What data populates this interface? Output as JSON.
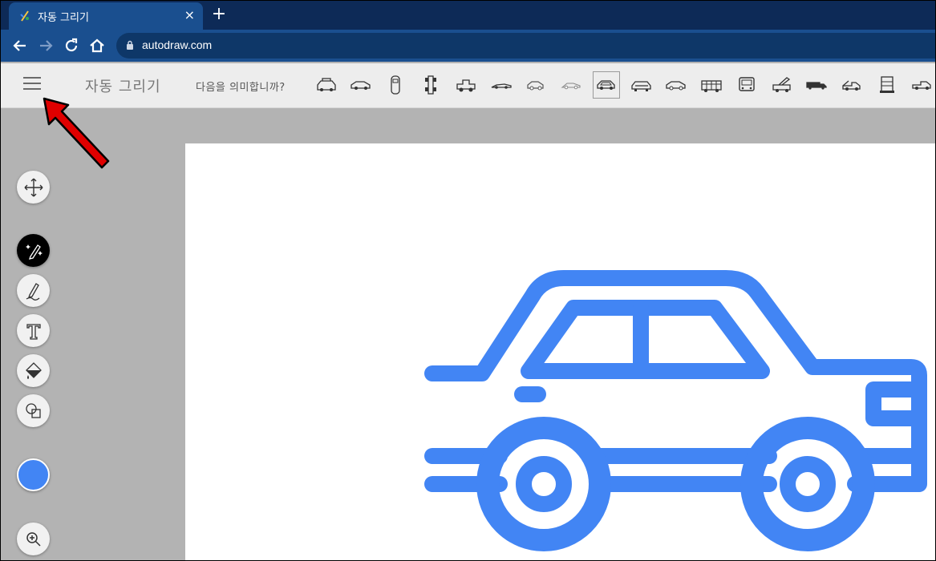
{
  "browser": {
    "tab_title": "자동 그리기",
    "tab_close": "×",
    "new_tab": "+",
    "url": "autodraw.com"
  },
  "app": {
    "title": "자동  그리기",
    "prompt": "다음을 의미합니까?",
    "suggestions": [
      "police-car-icon",
      "car-sedan-icon",
      "car-topview-icon",
      "race-car-icon",
      "tractor-icon",
      "sports-car-icon",
      "small-car-icon",
      "coupe-icon",
      "car-front-icon",
      "sedan-icon",
      "hatchback-icon",
      "fire-truck-icon",
      "bus-front-icon",
      "crane-truck-icon",
      "truck-icon",
      "tow-truck-icon",
      "semi-truck-icon",
      "pickup-icon"
    ],
    "selected_suggestion": 8
  },
  "tools": [
    "move-icon",
    "autodraw-icon",
    "draw-icon",
    "type-icon",
    "fill-icon",
    "shape-icon",
    "color-swatch",
    "zoom-icon"
  ],
  "colors": {
    "accent": "#4285f4",
    "car_stroke": "#4285f4",
    "annotation_arrow": "#e00000"
  }
}
